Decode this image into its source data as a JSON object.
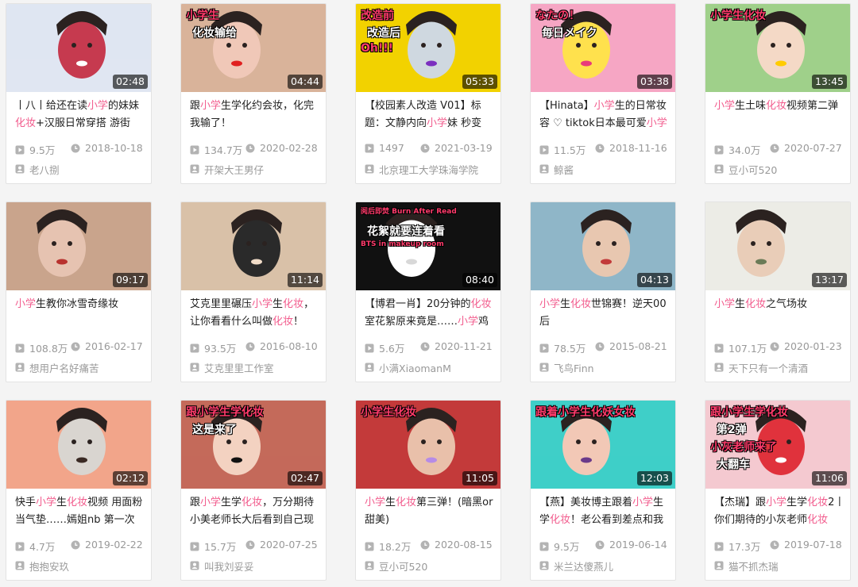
{
  "colors": {
    "highlight": "#f25d8e",
    "meta": "#999999",
    "title": "#212121"
  },
  "icons": {
    "plays": "play-count-icon",
    "date": "clock-icon",
    "author": "user-icon"
  },
  "videos": [
    {
      "duration": "02:48",
      "title_parts": [
        {
          "t": "丨八丨给还在读"
        },
        {
          "t": "小学",
          "hl": true
        },
        {
          "t": "的妹妹"
        },
        {
          "t": "化妆",
          "hl": true
        },
        {
          "t": "+汉服日常穿搭 游街"
        }
      ],
      "plays": "9.5万",
      "date": "2018-10-18",
      "author": "老八捌",
      "thumb_text": [],
      "palette": [
        "#dfe6f2",
        "#c63a4f",
        "#ffffff"
      ]
    },
    {
      "duration": "04:44",
      "title_parts": [
        {
          "t": "跟"
        },
        {
          "t": "小学",
          "hl": true
        },
        {
          "t": "生学化约会妆，化完我输了！"
        }
      ],
      "plays": "134.7万",
      "date": "2020-02-28",
      "author": "开架大王男仔",
      "thumb_text": [
        "小学生",
        "化妆输给"
      ],
      "palette": [
        "#d9b39a",
        "#f0c8b8",
        "#e02020"
      ]
    },
    {
      "duration": "05:33",
      "title_parts": [
        {
          "t": "【校园素人改造 V01】标题：文静内向"
        },
        {
          "t": "小学",
          "hl": true
        },
        {
          "t": "妹 秒变"
        }
      ],
      "plays": "1497",
      "date": "2021-03-19",
      "author": "北京理工大学珠海学院",
      "thumb_text": [
        "改造前",
        "改造后",
        "Oh!!!"
      ],
      "palette": [
        "#f2d200",
        "#cfd8e0",
        "#7b2fbf"
      ]
    },
    {
      "duration": "03:38",
      "title_parts": [
        {
          "t": "【Hinata】"
        },
        {
          "t": "小学",
          "hl": true
        },
        {
          "t": "生的日常妆容 ♡ tiktok日本最可爱"
        },
        {
          "t": "小学",
          "hl": true
        }
      ],
      "plays": "11.5万",
      "date": "2018-11-16",
      "author": "鲸酱",
      "thumb_text": [
        "なたの！",
        "毎日メイク"
      ],
      "palette": [
        "#f6a6c4",
        "#ffe14d",
        "#e83a7a"
      ]
    },
    {
      "duration": "13:45",
      "title_parts": [
        {
          "t": "小学",
          "hl": true
        },
        {
          "t": "生土味"
        },
        {
          "t": "化妆",
          "hl": true
        },
        {
          "t": "视频第二弹"
        }
      ],
      "plays": "34.0万",
      "date": "2020-07-27",
      "author": "豆小可520",
      "thumb_text": [
        "小学生化妆"
      ],
      "palette": [
        "#9fd08a",
        "#f4d9c6",
        "#ffcc00"
      ]
    },
    {
      "duration": "09:17",
      "title_parts": [
        {
          "t": "小学",
          "hl": true
        },
        {
          "t": "生教你冰雪奇缘妆"
        }
      ],
      "plays": "108.8万",
      "date": "2016-02-17",
      "author": "想用户名好痛苦",
      "thumb_text": [],
      "palette": [
        "#c9a48c",
        "#e6c3b1",
        "#b8322e"
      ]
    },
    {
      "duration": "11:14",
      "title_parts": [
        {
          "t": "艾克里里碾压"
        },
        {
          "t": "小学",
          "hl": true
        },
        {
          "t": "生"
        },
        {
          "t": "化妆",
          "hl": true
        },
        {
          "t": "，让你看看什么叫做"
        },
        {
          "t": "化妆",
          "hl": true
        },
        {
          "t": "！"
        }
      ],
      "plays": "93.5万",
      "date": "2016-08-10",
      "author": "艾克里里工作室",
      "thumb_text": [],
      "palette": [
        "#d9c1a8",
        "#2a2a2a",
        "#f1dcc8"
      ]
    },
    {
      "duration": "08:40",
      "title_parts": [
        {
          "t": "【博君一肖】20分钟的"
        },
        {
          "t": "化妆",
          "hl": true
        },
        {
          "t": "室花絮原来竟是……"
        },
        {
          "t": "小学",
          "hl": true
        },
        {
          "t": "鸡"
        }
      ],
      "plays": "5.6万",
      "date": "2020-11-21",
      "author": "小满XiaomanM",
      "thumb_text": [
        "阅后即焚 Burn After Read",
        "花絮就要连着看",
        "BTS in makeup room"
      ],
      "palette": [
        "#111111",
        "#ffffff",
        "#d8d8d8"
      ]
    },
    {
      "duration": "04:13",
      "title_parts": [
        {
          "t": "小学",
          "hl": true
        },
        {
          "t": "生"
        },
        {
          "t": "化妆",
          "hl": true
        },
        {
          "t": "世锦赛！逆天00后"
        }
      ],
      "plays": "78.5万",
      "date": "2015-08-21",
      "author": "飞鸟Finn",
      "thumb_text": [],
      "palette": [
        "#8fb6c8",
        "#e8c7b0",
        "#c23a3a"
      ]
    },
    {
      "duration": "13:17",
      "title_parts": [
        {
          "t": "小学",
          "hl": true
        },
        {
          "t": "生"
        },
        {
          "t": "化妆",
          "hl": true
        },
        {
          "t": "之气场妆"
        }
      ],
      "plays": "107.1万",
      "date": "2020-01-23",
      "author": "天下只有一个清酒",
      "thumb_text": [],
      "palette": [
        "#ecece6",
        "#e9cdb8",
        "#6b7b57"
      ]
    },
    {
      "duration": "02:12",
      "title_parts": [
        {
          "t": "快手"
        },
        {
          "t": "小学",
          "hl": true
        },
        {
          "t": "生"
        },
        {
          "t": "化妆",
          "hl": true
        },
        {
          "t": "视频 用面粉当气垫……嫣姐nb 第一次"
        }
      ],
      "plays": "4.7万",
      "date": "2019-02-22",
      "author": "抱抱安玖",
      "thumb_text": [],
      "palette": [
        "#f2a58a",
        "#d9d5d0",
        "#3a2a24"
      ]
    },
    {
      "duration": "02:47",
      "title_parts": [
        {
          "t": "跟"
        },
        {
          "t": "小学",
          "hl": true
        },
        {
          "t": "生学"
        },
        {
          "t": "化妆",
          "hl": true
        },
        {
          "t": "，万分期待小美老师长大后看到自己现"
        }
      ],
      "plays": "15.7万",
      "date": "2020-07-25",
      "author": "叫我刘妥妥",
      "thumb_text": [
        "跟小学生学化妆",
        "这是来了"
      ],
      "palette": [
        "#c46a5a",
        "#f3d2c1",
        "#111111"
      ]
    },
    {
      "duration": "11:05",
      "title_parts": [
        {
          "t": "小学",
          "hl": true
        },
        {
          "t": "生"
        },
        {
          "t": "化妆",
          "hl": true
        },
        {
          "t": "第三弹！(暗黑or甜美)"
        }
      ],
      "plays": "18.2万",
      "date": "2020-08-15",
      "author": "豆小可520",
      "thumb_text": [
        "小学生化妆"
      ],
      "palette": [
        "#c33a3a",
        "#e9c0aa",
        "#b68be6"
      ]
    },
    {
      "duration": "12:03",
      "title_parts": [
        {
          "t": "【燕】美妆博主跟着"
        },
        {
          "t": "小学",
          "hl": true
        },
        {
          "t": "生学"
        },
        {
          "t": "化妆",
          "hl": true
        },
        {
          "t": "！老公看到差点和我"
        }
      ],
      "plays": "9.5万",
      "date": "2019-06-14",
      "author": "米兰达傻燕儿",
      "thumb_text": [
        "跟着小学生化妖女妆"
      ],
      "palette": [
        "#3fcfc8",
        "#f2c8b6",
        "#6a3a8a"
      ]
    },
    {
      "duration": "11:06",
      "title_parts": [
        {
          "t": "【杰瑞】跟"
        },
        {
          "t": "小学",
          "hl": true
        },
        {
          "t": "生学"
        },
        {
          "t": "化妆",
          "hl": true
        },
        {
          "t": "2丨你们期待的小灰老师"
        },
        {
          "t": "化妆",
          "hl": true
        }
      ],
      "plays": "17.3万",
      "date": "2019-07-18",
      "author": "猫不抓杰瑞",
      "thumb_text": [
        "跟小学生学化妆",
        "第2弹",
        "小灰老师来了",
        "大翻车"
      ],
      "palette": [
        "#f4c9d0",
        "#e0323c",
        "#ffffff"
      ]
    }
  ]
}
